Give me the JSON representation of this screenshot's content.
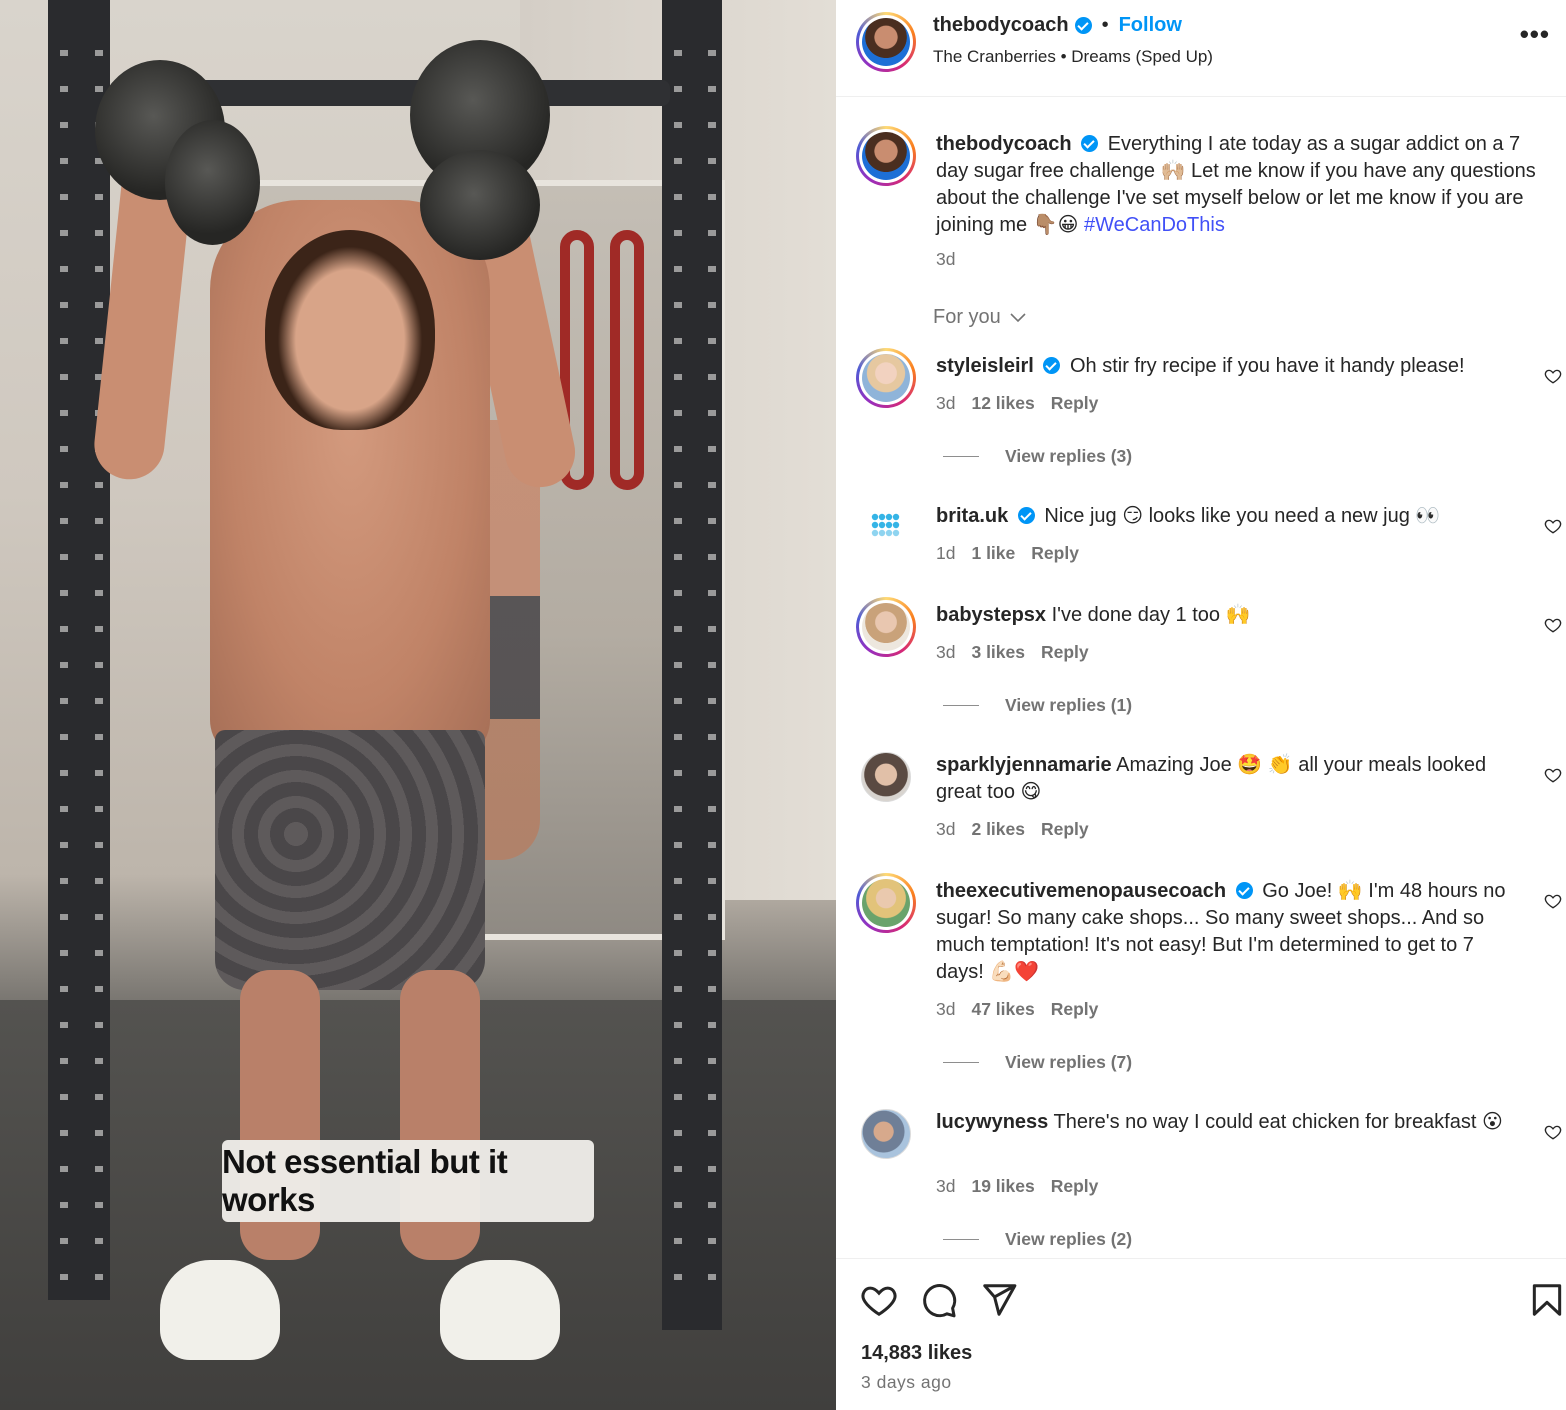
{
  "video": {
    "overlay_caption": "Not essential but it works"
  },
  "header": {
    "username": "thebodycoach",
    "follow_label": "Follow",
    "separator": "•",
    "audio_artist": "The Cranberries",
    "audio_track": "Dreams (Sped Up)",
    "more_label": "•••"
  },
  "post_caption": {
    "username": "thebodycoach",
    "text": "Everything I ate today as a sugar addict on a 7 day sugar free challenge 🙌🏼 Let me know if you have any questions about the challenge I've set myself below or let me know if you are joining me 👇🏽😀 ",
    "hashtag": "#WeCanDoThis",
    "time": "3d"
  },
  "sort_label": "For you",
  "comments": [
    {
      "username": "styleisleirl",
      "verified": true,
      "text": "Oh stir fry recipe if you have it handy please!",
      "time": "3d",
      "likes": "12 likes",
      "reply": "Reply",
      "view_replies": "View replies (3)"
    },
    {
      "username": "brita.uk",
      "verified": true,
      "text": "Nice jug 😏 looks like you need a new jug 👀",
      "time": "1d",
      "likes": "1 like",
      "reply": "Reply"
    },
    {
      "username": "babystepsx",
      "verified": false,
      "text": "I've done day 1 too 🙌",
      "time": "3d",
      "likes": "3 likes",
      "reply": "Reply",
      "view_replies": "View replies (1)"
    },
    {
      "username": "sparklyjennamarie",
      "verified": false,
      "text": "Amazing Joe 🤩 👏 all your meals looked great too 😋",
      "time": "3d",
      "likes": "2 likes",
      "reply": "Reply"
    },
    {
      "username": "theexecutivemenopausecoach",
      "verified": true,
      "text": "Go Joe! 🙌 I'm 48 hours no sugar! So many cake shops... So many sweet shops... And so much temptation! It's not easy! But I'm determined to get to 7 days! 💪🏻❤️",
      "time": "3d",
      "likes": "47 likes",
      "reply": "Reply",
      "view_replies": "View replies (7)"
    },
    {
      "username": "lucywyness",
      "verified": false,
      "text": "There's no way I could eat chicken for breakfast 😮",
      "time": "3d",
      "likes": "19 likes",
      "reply": "Reply",
      "view_replies": "View replies (2)"
    }
  ],
  "footer": {
    "likes": "14,883 likes",
    "posted": "3 days ago"
  },
  "icons": {
    "like": "heart-icon",
    "comment": "comment-bubble-icon",
    "share": "paper-plane-icon",
    "save": "bookmark-icon",
    "more": "more-dots-icon",
    "verified": "verified-badge-icon",
    "chevron": "chevron-down-icon"
  },
  "colors": {
    "link": "#0095f6",
    "hashtag": "#4150f7",
    "muted": "#737373",
    "text": "#262626"
  }
}
